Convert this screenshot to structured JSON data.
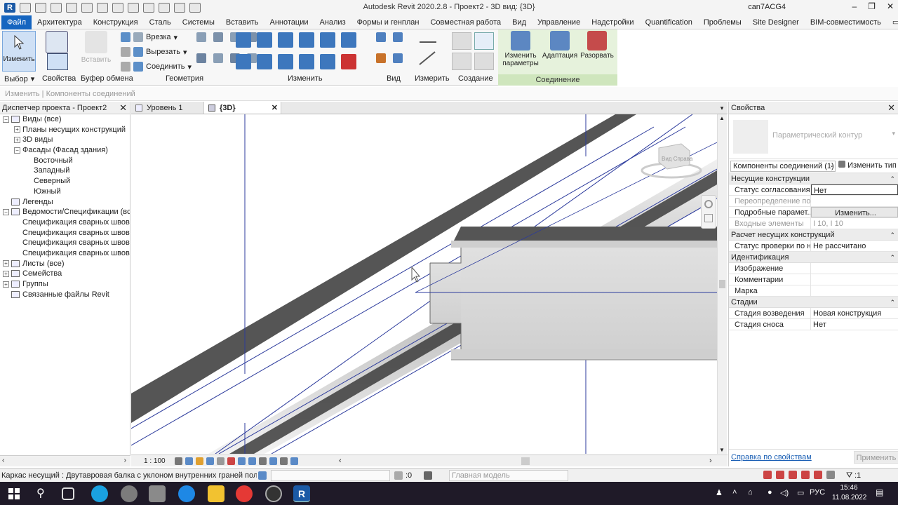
{
  "app": {
    "title": "Autodesk Revit 2020.2.8 - Проект2 - 3D вид: {3D}",
    "user": "can7ACG4",
    "logo": "R"
  },
  "tabs": [
    "Файл",
    "Архитектура",
    "Конструкция",
    "Сталь",
    "Системы",
    "Вставить",
    "Аннотации",
    "Анализ",
    "Формы и генплан",
    "Совместная работа",
    "Вид",
    "Управление",
    "Надстройки",
    "Quantification",
    "Проблемы",
    "Site Designer",
    "BIM-совместимость"
  ],
  "ribbon": {
    "modify": "Изменить",
    "select": "Выбор",
    "properties": "Свойства",
    "paste": "Вставить",
    "clipboard": "Буфер обмена",
    "cut": "Врезка",
    "cut2": "Вырезать",
    "join": "Соединить",
    "geometry": "Геометрия",
    "modify_panel": "Изменить",
    "view": "Вид",
    "measure": "Измерить",
    "create": "Создание",
    "edit_params": "Изменить параметры",
    "adapt": "Адаптация",
    "explode": "Разорвать",
    "connection": "Соединение"
  },
  "options_bar": "Изменить | Компоненты соединений",
  "browser": {
    "title": "Диспетчер проекта - Проект2",
    "items": [
      {
        "t": "Виды (все)",
        "lvl": 0,
        "tg": "-"
      },
      {
        "t": "Планы несущих конструкций",
        "lvl": 1,
        "tg": "+"
      },
      {
        "t": "3D виды",
        "lvl": 1,
        "tg": "+"
      },
      {
        "t": "Фасады (Фасад здания)",
        "lvl": 1,
        "tg": "-"
      },
      {
        "t": "Восточный",
        "lvl": 2,
        "tg": ""
      },
      {
        "t": "Западный",
        "lvl": 2,
        "tg": ""
      },
      {
        "t": "Северный",
        "lvl": 2,
        "tg": ""
      },
      {
        "t": "Южный",
        "lvl": 2,
        "tg": ""
      },
      {
        "t": "Легенды",
        "lvl": 0,
        "tg": ""
      },
      {
        "t": "Ведомости/Спецификации (все",
        "lvl": 0,
        "tg": "-"
      },
      {
        "t": "Спецификация сварных швов",
        "lvl": 1,
        "tg": ""
      },
      {
        "t": "Спецификация сварных швов",
        "lvl": 1,
        "tg": ""
      },
      {
        "t": "Спецификация сварных швов",
        "lvl": 1,
        "tg": ""
      },
      {
        "t": "Спецификация сварных швов",
        "lvl": 1,
        "tg": ""
      },
      {
        "t": "Листы (все)",
        "lvl": 0,
        "tg": "+"
      },
      {
        "t": "Семейства",
        "lvl": 0,
        "tg": "+"
      },
      {
        "t": "Группы",
        "lvl": 0,
        "tg": "+"
      },
      {
        "t": "Связанные файлы Revit",
        "lvl": 0,
        "tg": ""
      }
    ]
  },
  "view_tabs": {
    "t1": "Уровень 1",
    "t2": "{3D}"
  },
  "view_scale": "1 : 100",
  "viewcube": "Вид Справа",
  "props": {
    "title": "Свойства",
    "family": "Параметрический контур",
    "type_selector": "Компоненты соединений (1)",
    "edit_type": "Изменить тип",
    "groups": [
      {
        "name": "Несущие конструкции",
        "rows": [
          {
            "k": "Статус согласования",
            "v": "Нет",
            "box": true
          },
          {
            "k": "Переопределение по...",
            "v": "",
            "dim": true
          },
          {
            "k": "Подробные парамет...",
            "v": "Изменить...",
            "btn": true
          },
          {
            "k": "Входные элементы",
            "v": "I 10, I 10",
            "dim": true
          }
        ]
      },
      {
        "name": "Расчет несущих конструкций",
        "rows": [
          {
            "k": "Статус проверки по н...",
            "v": "Не рассчитано"
          }
        ]
      },
      {
        "name": "Идентификация",
        "rows": [
          {
            "k": "Изображение",
            "v": ""
          },
          {
            "k": "Комментарии",
            "v": ""
          },
          {
            "k": "Марка",
            "v": ""
          }
        ]
      },
      {
        "name": "Стадии",
        "rows": [
          {
            "k": "Стадия возведения",
            "v": "Новая конструкция"
          },
          {
            "k": "Стадия сноса",
            "v": "Нет"
          }
        ]
      }
    ],
    "help": "Справка по свойствам",
    "apply": "Применить"
  },
  "status": {
    "text": "Каркас несущий : Двутавровая балка с уклоном внутренних граней полок (ГО",
    "zero": ":0",
    "model": "Главная модель",
    "filter": ":1"
  },
  "taskbar": {
    "lang": "РУС",
    "time": "15:46",
    "date": "11.08.2022"
  },
  "colors": {
    "accent": "#1565c0",
    "taskbar": "#1f1a28",
    "beam_dark": "#555555",
    "beam_light": "#cfcfcf",
    "model_lines": "#2b3a9c"
  }
}
